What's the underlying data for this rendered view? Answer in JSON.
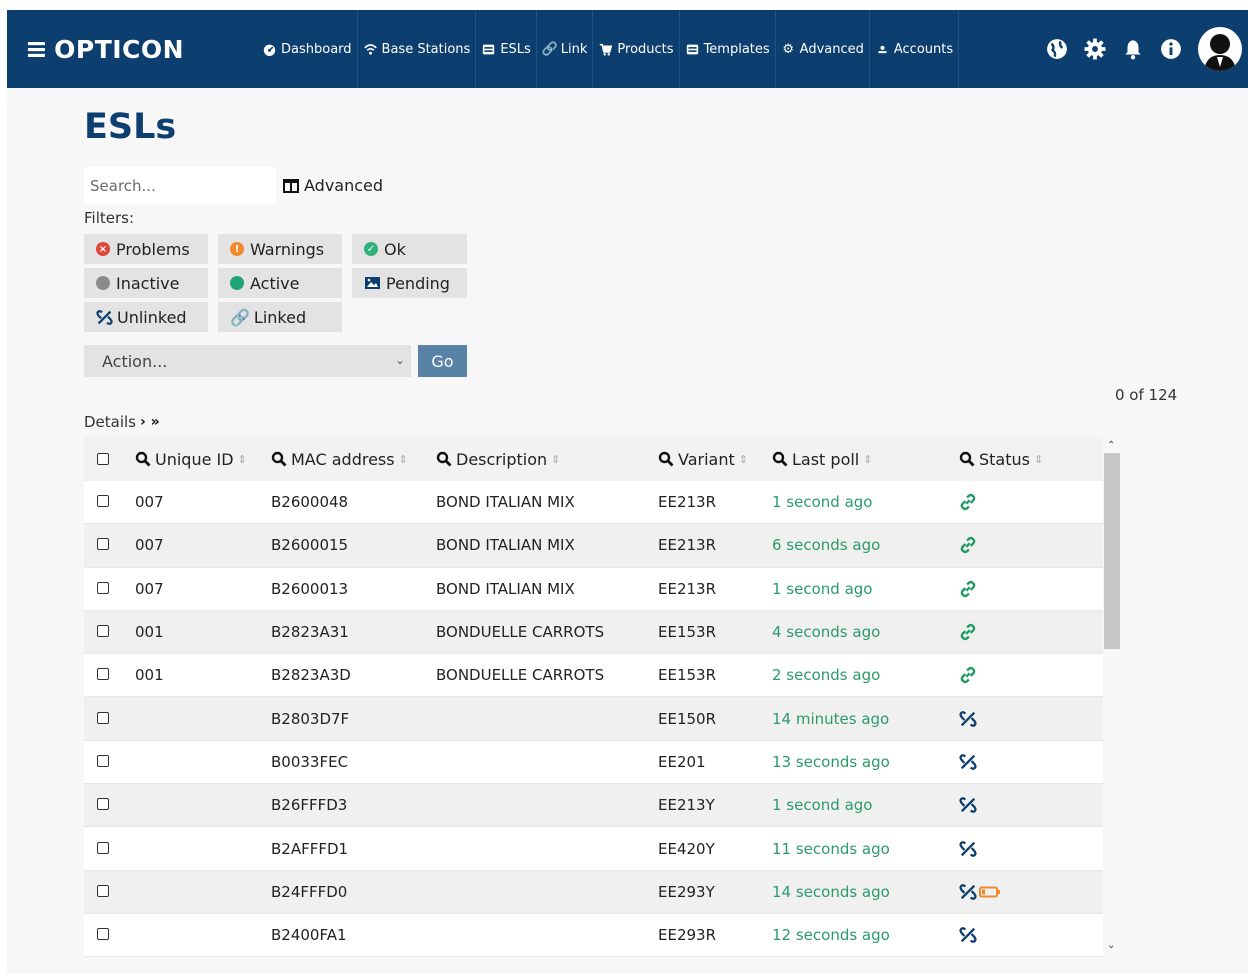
{
  "app": {
    "brand": "OPTICON"
  },
  "nav": [
    {
      "label": "Dashboard",
      "icon": "dashboard-icon"
    },
    {
      "label": "Base Stations",
      "icon": "wifi-icon"
    },
    {
      "label": "ESLs",
      "icon": "esl-icon"
    },
    {
      "label": "Link",
      "icon": "link-icon"
    },
    {
      "label": "Products",
      "icon": "cart-icon"
    },
    {
      "label": "Templates",
      "icon": "template-icon"
    },
    {
      "label": "Advanced",
      "icon": "cogs-icon"
    },
    {
      "label": "Accounts",
      "icon": "user-icon"
    }
  ],
  "header_icons": [
    "globe-icon",
    "gear-icon",
    "bell-icon",
    "info-icon",
    "avatar"
  ],
  "page": {
    "title": "ESLs"
  },
  "search": {
    "placeholder": "Search..."
  },
  "advanced_label": "Advanced",
  "filters": {
    "label": "Filters:",
    "buttons": [
      {
        "label": "Problems",
        "color": "#e0443c"
      },
      {
        "label": "Warnings",
        "color": "#f08a2c"
      },
      {
        "label": "Ok",
        "color": "#2fb27a"
      },
      {
        "label": "Inactive",
        "color": "#8a8a8a"
      },
      {
        "label": "Active",
        "color": "#1fa476"
      },
      {
        "label": "Pending",
        "color": "#0c3f6f"
      },
      {
        "label": "Unlinked",
        "color": "#0c3f6f"
      },
      {
        "label": "Linked",
        "color": "#1f9a63"
      }
    ]
  },
  "action": {
    "placeholder": "Action...",
    "go_label": "Go"
  },
  "count_text": "0 of 124",
  "details_label": "Details",
  "table": {
    "columns": [
      "Unique ID",
      "MAC address",
      "Description",
      "Variant",
      "Last poll",
      "Status"
    ],
    "rows": [
      {
        "uid": "007",
        "mac": "B2600048",
        "desc": "BOND ITALIAN MIX",
        "variant": "EE213R",
        "poll": "1 second ago",
        "status": "linked"
      },
      {
        "uid": "007",
        "mac": "B2600015",
        "desc": "BOND ITALIAN MIX",
        "variant": "EE213R",
        "poll": "6 seconds ago",
        "status": "linked"
      },
      {
        "uid": "007",
        "mac": "B2600013",
        "desc": "BOND ITALIAN MIX",
        "variant": "EE213R",
        "poll": "1 second ago",
        "status": "linked"
      },
      {
        "uid": "001",
        "mac": "B2823A31",
        "desc": "BONDUELLE CARROTS",
        "variant": "EE153R",
        "poll": "4 seconds ago",
        "status": "linked"
      },
      {
        "uid": "001",
        "mac": "B2823A3D",
        "desc": "BONDUELLE CARROTS",
        "variant": "EE153R",
        "poll": "2 seconds ago",
        "status": "linked"
      },
      {
        "uid": "",
        "mac": "B2803D7F",
        "desc": "",
        "variant": "EE150R",
        "poll": "14 minutes ago",
        "status": "unlinked"
      },
      {
        "uid": "",
        "mac": "B0033FEC",
        "desc": "",
        "variant": "EE201",
        "poll": "13 seconds ago",
        "status": "unlinked"
      },
      {
        "uid": "",
        "mac": "B26FFFD3",
        "desc": "",
        "variant": "EE213Y",
        "poll": "1 second ago",
        "status": "unlinked"
      },
      {
        "uid": "",
        "mac": "B2AFFFD1",
        "desc": "",
        "variant": "EE420Y",
        "poll": "11 seconds ago",
        "status": "unlinked"
      },
      {
        "uid": "",
        "mac": "B24FFFD0",
        "desc": "",
        "variant": "EE293Y",
        "poll": "14 seconds ago",
        "status": "unlinked-lowbattery"
      },
      {
        "uid": "",
        "mac": "B2400FA1",
        "desc": "",
        "variant": "EE293R",
        "poll": "12 seconds ago",
        "status": "unlinked"
      }
    ]
  }
}
